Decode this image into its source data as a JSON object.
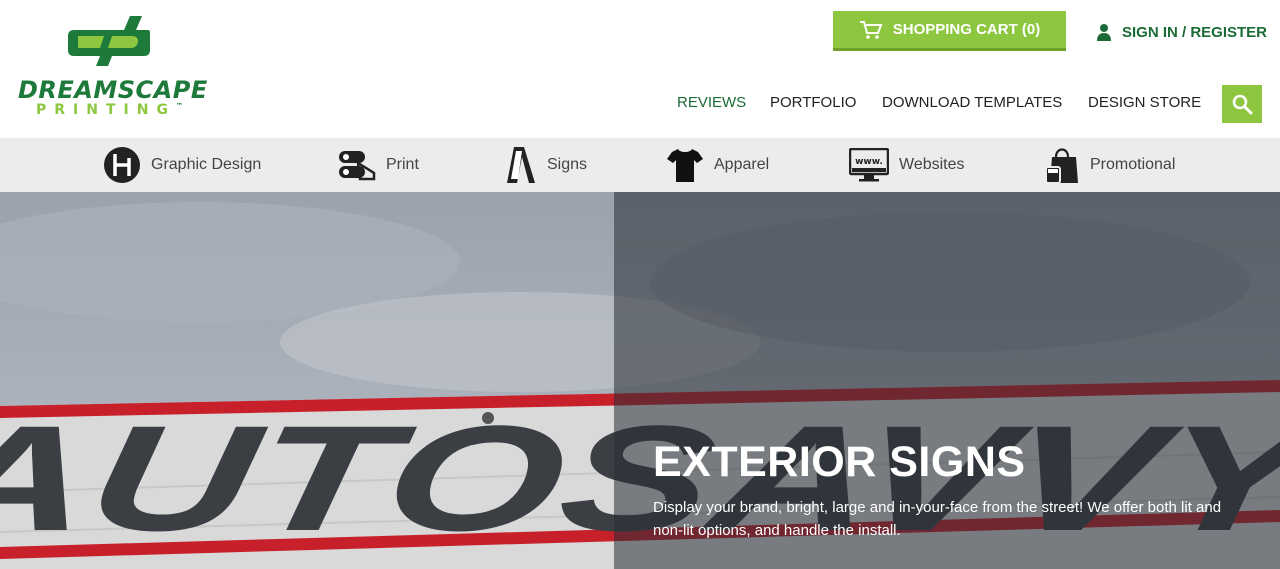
{
  "brand": {
    "name_line1": "DREAMSCAPE",
    "name_line2": "PRINTING",
    "trademark": "™",
    "colors": {
      "primary_green": "#1d7a3a",
      "accent_green": "#8dc63f"
    }
  },
  "header": {
    "cart_label": "SHOPPING CART (0)",
    "cart_icon": "cart-icon",
    "signin_label": "SIGN IN / REGISTER",
    "signin_icon": "user-icon",
    "search_icon": "search-icon"
  },
  "nav": {
    "items": [
      {
        "label": "REVIEWS",
        "active": true
      },
      {
        "label": "PORTFOLIO",
        "active": false
      },
      {
        "label": "DOWNLOAD TEMPLATES",
        "active": false
      },
      {
        "label": "DESIGN STORE",
        "active": false
      }
    ]
  },
  "categories": {
    "items": [
      {
        "label": "Graphic Design",
        "icon": "graphic-design-icon"
      },
      {
        "label": "Print",
        "icon": "print-icon"
      },
      {
        "label": "Signs",
        "icon": "signs-icon"
      },
      {
        "label": "Apparel",
        "icon": "apparel-icon"
      },
      {
        "label": "Websites",
        "icon": "websites-icon"
      },
      {
        "label": "Promotional",
        "icon": "promotional-icon"
      }
    ]
  },
  "hero": {
    "title": "EXTERIOR SIGNS",
    "description": "Display your brand, bright, large and in-your-face from the street! We offer both lit and non-lit options, and handle the install.",
    "image_sign_text": "AUTOSAVVY"
  }
}
